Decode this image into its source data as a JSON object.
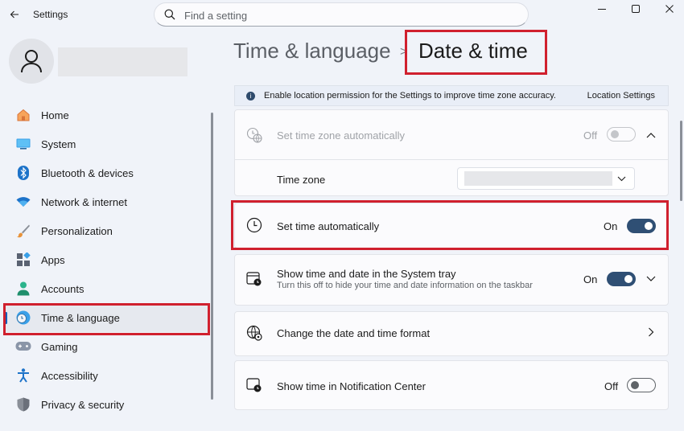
{
  "app": {
    "title": "Settings"
  },
  "search": {
    "placeholder": "Find a setting"
  },
  "nav": {
    "items": [
      {
        "label": "Home",
        "icon": "home-icon"
      },
      {
        "label": "System",
        "icon": "system-icon"
      },
      {
        "label": "Bluetooth & devices",
        "icon": "bluetooth-icon"
      },
      {
        "label": "Network & internet",
        "icon": "wifi-icon"
      },
      {
        "label": "Personalization",
        "icon": "brush-icon"
      },
      {
        "label": "Apps",
        "icon": "apps-icon"
      },
      {
        "label": "Accounts",
        "icon": "accounts-icon"
      },
      {
        "label": "Time & language",
        "icon": "time-language-icon",
        "active": true
      },
      {
        "label": "Gaming",
        "icon": "gaming-icon"
      },
      {
        "label": "Accessibility",
        "icon": "accessibility-icon"
      },
      {
        "label": "Privacy & security",
        "icon": "shield-icon"
      }
    ]
  },
  "breadcrumb": {
    "parent": "Time & language",
    "separator": ">",
    "current": "Date & time"
  },
  "info_bar": {
    "text": "Enable location permission for the Settings to improve time zone accuracy.",
    "link": "Location Settings"
  },
  "settings": {
    "tz_auto": {
      "label": "Set time zone automatically",
      "state": "Off",
      "enabled": false
    },
    "time_zone": {
      "label": "Time zone"
    },
    "time_auto": {
      "label": "Set time automatically",
      "state": "On"
    },
    "systray": {
      "label": "Show time and date in the System tray",
      "sub": "Turn this off to hide your time and date information on the taskbar",
      "state": "On"
    },
    "format": {
      "label": "Change the date and time format"
    },
    "notification": {
      "label": "Show time in Notification Center",
      "state": "Off"
    }
  },
  "colors": {
    "highlight": "#d0202e",
    "accent": "#005fb8",
    "toggle_on": "#2f4f74"
  }
}
